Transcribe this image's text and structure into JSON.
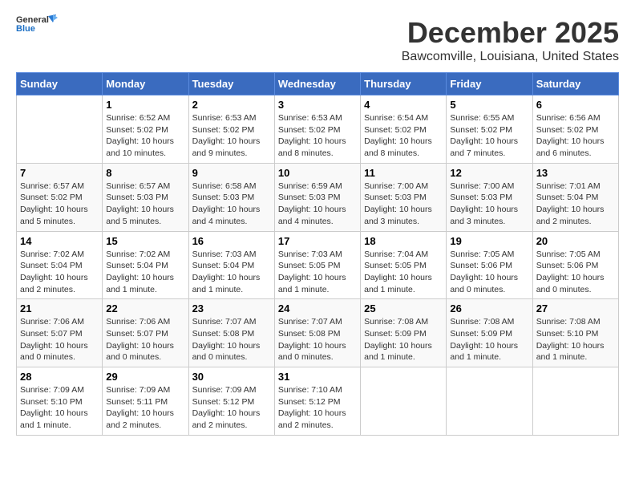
{
  "logo": {
    "line1": "General",
    "line2": "Blue"
  },
  "title": "December 2025",
  "location": "Bawcomville, Louisiana, United States",
  "days_of_week": [
    "Sunday",
    "Monday",
    "Tuesday",
    "Wednesday",
    "Thursday",
    "Friday",
    "Saturday"
  ],
  "weeks": [
    [
      {
        "day": "",
        "info": ""
      },
      {
        "day": "1",
        "info": "Sunrise: 6:52 AM\nSunset: 5:02 PM\nDaylight: 10 hours and 10 minutes."
      },
      {
        "day": "2",
        "info": "Sunrise: 6:53 AM\nSunset: 5:02 PM\nDaylight: 10 hours and 9 minutes."
      },
      {
        "day": "3",
        "info": "Sunrise: 6:53 AM\nSunset: 5:02 PM\nDaylight: 10 hours and 8 minutes."
      },
      {
        "day": "4",
        "info": "Sunrise: 6:54 AM\nSunset: 5:02 PM\nDaylight: 10 hours and 8 minutes."
      },
      {
        "day": "5",
        "info": "Sunrise: 6:55 AM\nSunset: 5:02 PM\nDaylight: 10 hours and 7 minutes."
      },
      {
        "day": "6",
        "info": "Sunrise: 6:56 AM\nSunset: 5:02 PM\nDaylight: 10 hours and 6 minutes."
      }
    ],
    [
      {
        "day": "7",
        "info": "Sunrise: 6:57 AM\nSunset: 5:02 PM\nDaylight: 10 hours and 5 minutes."
      },
      {
        "day": "8",
        "info": "Sunrise: 6:57 AM\nSunset: 5:03 PM\nDaylight: 10 hours and 5 minutes."
      },
      {
        "day": "9",
        "info": "Sunrise: 6:58 AM\nSunset: 5:03 PM\nDaylight: 10 hours and 4 minutes."
      },
      {
        "day": "10",
        "info": "Sunrise: 6:59 AM\nSunset: 5:03 PM\nDaylight: 10 hours and 4 minutes."
      },
      {
        "day": "11",
        "info": "Sunrise: 7:00 AM\nSunset: 5:03 PM\nDaylight: 10 hours and 3 minutes."
      },
      {
        "day": "12",
        "info": "Sunrise: 7:00 AM\nSunset: 5:03 PM\nDaylight: 10 hours and 3 minutes."
      },
      {
        "day": "13",
        "info": "Sunrise: 7:01 AM\nSunset: 5:04 PM\nDaylight: 10 hours and 2 minutes."
      }
    ],
    [
      {
        "day": "14",
        "info": "Sunrise: 7:02 AM\nSunset: 5:04 PM\nDaylight: 10 hours and 2 minutes."
      },
      {
        "day": "15",
        "info": "Sunrise: 7:02 AM\nSunset: 5:04 PM\nDaylight: 10 hours and 1 minute."
      },
      {
        "day": "16",
        "info": "Sunrise: 7:03 AM\nSunset: 5:04 PM\nDaylight: 10 hours and 1 minute."
      },
      {
        "day": "17",
        "info": "Sunrise: 7:03 AM\nSunset: 5:05 PM\nDaylight: 10 hours and 1 minute."
      },
      {
        "day": "18",
        "info": "Sunrise: 7:04 AM\nSunset: 5:05 PM\nDaylight: 10 hours and 1 minute."
      },
      {
        "day": "19",
        "info": "Sunrise: 7:05 AM\nSunset: 5:06 PM\nDaylight: 10 hours and 0 minutes."
      },
      {
        "day": "20",
        "info": "Sunrise: 7:05 AM\nSunset: 5:06 PM\nDaylight: 10 hours and 0 minutes."
      }
    ],
    [
      {
        "day": "21",
        "info": "Sunrise: 7:06 AM\nSunset: 5:07 PM\nDaylight: 10 hours and 0 minutes."
      },
      {
        "day": "22",
        "info": "Sunrise: 7:06 AM\nSunset: 5:07 PM\nDaylight: 10 hours and 0 minutes."
      },
      {
        "day": "23",
        "info": "Sunrise: 7:07 AM\nSunset: 5:08 PM\nDaylight: 10 hours and 0 minutes."
      },
      {
        "day": "24",
        "info": "Sunrise: 7:07 AM\nSunset: 5:08 PM\nDaylight: 10 hours and 0 minutes."
      },
      {
        "day": "25",
        "info": "Sunrise: 7:08 AM\nSunset: 5:09 PM\nDaylight: 10 hours and 1 minute."
      },
      {
        "day": "26",
        "info": "Sunrise: 7:08 AM\nSunset: 5:09 PM\nDaylight: 10 hours and 1 minute."
      },
      {
        "day": "27",
        "info": "Sunrise: 7:08 AM\nSunset: 5:10 PM\nDaylight: 10 hours and 1 minute."
      }
    ],
    [
      {
        "day": "28",
        "info": "Sunrise: 7:09 AM\nSunset: 5:10 PM\nDaylight: 10 hours and 1 minute."
      },
      {
        "day": "29",
        "info": "Sunrise: 7:09 AM\nSunset: 5:11 PM\nDaylight: 10 hours and 2 minutes."
      },
      {
        "day": "30",
        "info": "Sunrise: 7:09 AM\nSunset: 5:12 PM\nDaylight: 10 hours and 2 minutes."
      },
      {
        "day": "31",
        "info": "Sunrise: 7:10 AM\nSunset: 5:12 PM\nDaylight: 10 hours and 2 minutes."
      },
      {
        "day": "",
        "info": ""
      },
      {
        "day": "",
        "info": ""
      },
      {
        "day": "",
        "info": ""
      }
    ]
  ]
}
